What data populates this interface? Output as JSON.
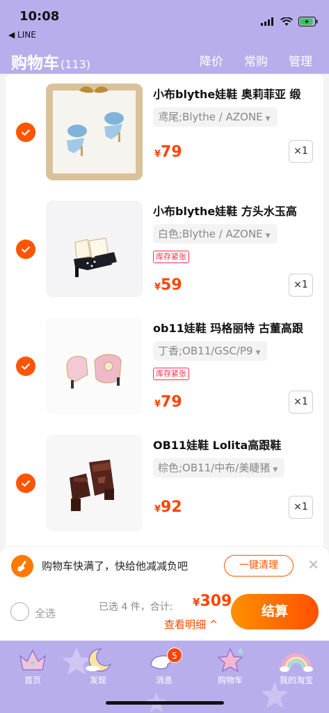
{
  "status": {
    "time": "10:08",
    "back_app": "◀ LINE"
  },
  "header": {
    "title": "购物车",
    "count": "(113)",
    "nav": [
      "降价",
      "常购",
      "管理"
    ]
  },
  "items": [
    {
      "name": "小布blythe娃鞋 奥莉菲亚 缎",
      "sku": "鸢尾;Blythe / AZONE",
      "stock": "",
      "currency": "¥",
      "price": "79",
      "qty": "×1"
    },
    {
      "name": "小布blythe娃鞋 方头水玉高",
      "sku": "白色;Blythe / AZONE",
      "stock": "库存紧张",
      "currency": "¥",
      "price": "59",
      "qty": "×1"
    },
    {
      "name": "ob11娃鞋 玛格丽特 古董高跟",
      "sku": "丁香;OB11/GSC/P9",
      "stock": "库存紧张",
      "currency": "¥",
      "price": "79",
      "qty": "×1"
    },
    {
      "name": "OB11娃鞋 Lolita高跟鞋",
      "sku": "棕色;OB11/中布/美睫猪",
      "stock": "",
      "currency": "¥",
      "price": "92",
      "qty": "×1"
    }
  ],
  "banner": {
    "text": "购物车快满了，快给他减减负吧",
    "button": "一键清理"
  },
  "checkout": {
    "select_all": "全选",
    "selected": "已选 4 件，合计:",
    "currency": "¥",
    "total": "309",
    "detail": "查看明细 ^",
    "pay": "结算"
  },
  "tabs": [
    {
      "label": "首页",
      "icon": "crown-icon"
    },
    {
      "label": "发现",
      "icon": "moon-icon"
    },
    {
      "label": "消息",
      "icon": "wing-icon",
      "badge": "5"
    },
    {
      "label": "购物车",
      "icon": "star-icon"
    },
    {
      "label": "我的淘宝",
      "icon": "rainbow-icon"
    }
  ],
  "colors": {
    "accent": "#ff5500",
    "price": "#ff4400",
    "theme": "#b9aeec"
  }
}
